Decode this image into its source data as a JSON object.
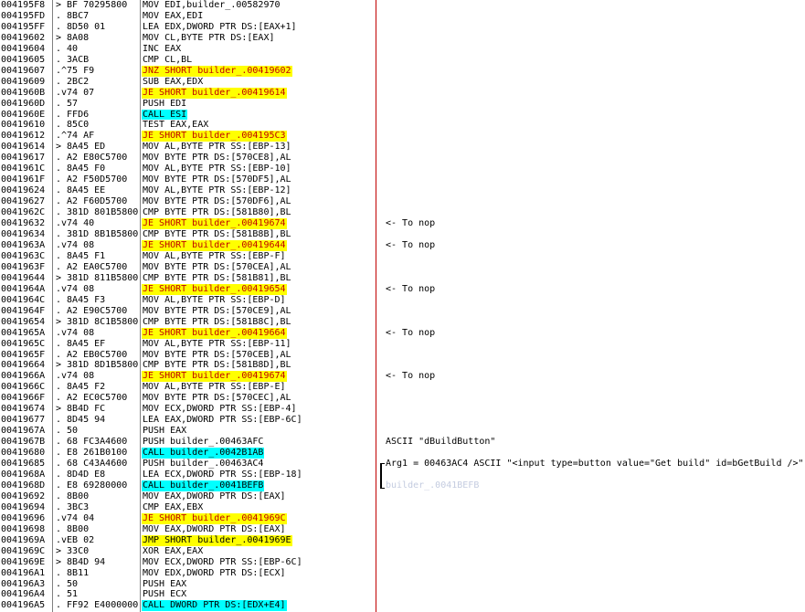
{
  "colors": {
    "text": "#000000",
    "background": "#ffffff",
    "column_divider": "#808080",
    "comment_divider": "#c00000"
  },
  "rows": [
    {
      "addr": "004195F8",
      "hex": "> BF 70295800",
      "asm": "MOV EDI,builder_.00582970"
    },
    {
      "addr": "004195FD",
      "hex": ". 8BC7",
      "asm": "MOV EAX,EDI"
    },
    {
      "addr": "004195FF",
      "hex": ". 8D50 01",
      "asm": "LEA EDX,DWORD PTR DS:[EAX+1]"
    },
    {
      "addr": "00419602",
      "hex": "> 8A08",
      "asm": "MOV CL,BYTE PTR DS:[EAX]"
    },
    {
      "addr": "00419604",
      "hex": ". 40",
      "asm": "INC EAX"
    },
    {
      "addr": "00419605",
      "hex": ". 3ACB",
      "asm": "CMP CL,BL"
    },
    {
      "addr": "00419607",
      "hex": ".^75 F9",
      "asm": "JNZ SHORT builder_.00419602",
      "bg": "#ffff00",
      "fg": "#c00000"
    },
    {
      "addr": "00419609",
      "hex": ". 2BC2",
      "asm": "SUB EAX,EDX"
    },
    {
      "addr": "0041960B",
      "hex": ".v74 07",
      "asm": "JE SHORT builder_.00419614",
      "bg": "#ffff00",
      "fg": "#c00000"
    },
    {
      "addr": "0041960D",
      "hex": ". 57",
      "asm": "PUSH EDI"
    },
    {
      "addr": "0041960E",
      "hex": ". FFD6",
      "asm": "CALL ESI",
      "bg": "#00ffff",
      "fg": "#000000"
    },
    {
      "addr": "00419610",
      "hex": ". 85C0",
      "asm": "TEST EAX,EAX"
    },
    {
      "addr": "00419612",
      "hex": ".^74 AF",
      "asm": "JE SHORT builder_.004195C3",
      "bg": "#ffff00",
      "fg": "#c00000"
    },
    {
      "addr": "00419614",
      "hex": "> 8A45 ED",
      "asm": "MOV AL,BYTE PTR SS:[EBP-13]"
    },
    {
      "addr": "00419617",
      "hex": ". A2 E80C5700",
      "asm": "MOV BYTE PTR DS:[570CE8],AL"
    },
    {
      "addr": "0041961C",
      "hex": ". 8A45 F0",
      "asm": "MOV AL,BYTE PTR SS:[EBP-10]"
    },
    {
      "addr": "0041961F",
      "hex": ". A2 F50D5700",
      "asm": "MOV BYTE PTR DS:[570DF5],AL"
    },
    {
      "addr": "00419624",
      "hex": ". 8A45 EE",
      "asm": "MOV AL,BYTE PTR SS:[EBP-12]"
    },
    {
      "addr": "00419627",
      "hex": ". A2 F60D5700",
      "asm": "MOV BYTE PTR DS:[570DF6],AL"
    },
    {
      "addr": "0041962C",
      "hex": ". 381D 801B5800",
      "asm": "CMP BYTE PTR DS:[581B80],BL"
    },
    {
      "addr": "00419632",
      "hex": ".v74 40",
      "asm": "JE SHORT builder_.00419674",
      "bg": "#ffff00",
      "fg": "#c00000",
      "comment": "<- To nop"
    },
    {
      "addr": "00419634",
      "hex": ". 381D 8B1B5800",
      "asm": "CMP BYTE PTR DS:[581B8B],BL"
    },
    {
      "addr": "0041963A",
      "hex": ".v74 08",
      "asm": "JE SHORT builder_.00419644",
      "bg": "#ffff00",
      "fg": "#c00000",
      "comment": "<- To nop"
    },
    {
      "addr": "0041963C",
      "hex": ". 8A45 F1",
      "asm": "MOV AL,BYTE PTR SS:[EBP-F]"
    },
    {
      "addr": "0041963F",
      "hex": ". A2 EA0C5700",
      "asm": "MOV BYTE PTR DS:[570CEA],AL"
    },
    {
      "addr": "00419644",
      "hex": "> 381D 811B5800",
      "asm": "CMP BYTE PTR DS:[581B81],BL"
    },
    {
      "addr": "0041964A",
      "hex": ".v74 08",
      "asm": "JE SHORT builder_.00419654",
      "bg": "#ffff00",
      "fg": "#c00000",
      "comment": "<- To nop"
    },
    {
      "addr": "0041964C",
      "hex": ". 8A45 F3",
      "asm": "MOV AL,BYTE PTR SS:[EBP-D]"
    },
    {
      "addr": "0041964F",
      "hex": ". A2 E90C5700",
      "asm": "MOV BYTE PTR DS:[570CE9],AL"
    },
    {
      "addr": "00419654",
      "hex": "> 381D 8C1B5800",
      "asm": "CMP BYTE PTR DS:[581B8C],BL"
    },
    {
      "addr": "0041965A",
      "hex": ".v74 08",
      "asm": "JE SHORT builder_.00419664",
      "bg": "#ffff00",
      "fg": "#c00000",
      "comment": "<- To nop"
    },
    {
      "addr": "0041965C",
      "hex": ". 8A45 EF",
      "asm": "MOV AL,BYTE PTR SS:[EBP-11]"
    },
    {
      "addr": "0041965F",
      "hex": ". A2 EB0C5700",
      "asm": "MOV BYTE PTR DS:[570CEB],AL"
    },
    {
      "addr": "00419664",
      "hex": "> 381D 8D1B5800",
      "asm": "CMP BYTE PTR DS:[581B8D],BL"
    },
    {
      "addr": "0041966A",
      "hex": ".v74 08",
      "asm": "JE SHORT builder_.00419674",
      "bg": "#ffff00",
      "fg": "#c00000",
      "comment": "<- To nop"
    },
    {
      "addr": "0041966C",
      "hex": ". 8A45 F2",
      "asm": "MOV AL,BYTE PTR SS:[EBP-E]"
    },
    {
      "addr": "0041966F",
      "hex": ". A2 EC0C5700",
      "asm": "MOV BYTE PTR DS:[570CEC],AL"
    },
    {
      "addr": "00419674",
      "hex": "> 8B4D FC",
      "asm": "MOV ECX,DWORD PTR SS:[EBP-4]"
    },
    {
      "addr": "00419677",
      "hex": ". 8D45 94",
      "asm": "LEA EAX,DWORD PTR SS:[EBP-6C]"
    },
    {
      "addr": "0041967A",
      "hex": ". 50",
      "asm": "PUSH EAX"
    },
    {
      "addr": "0041967B",
      "hex": ". 68 FC3A4600",
      "asm": "PUSH builder_.00463AFC",
      "comment": "ASCII \"dBuildButton\""
    },
    {
      "addr": "00419680",
      "hex": ". E8 261B0100",
      "asm": "CALL builder_.0042B1AB",
      "bg": "#00ffff",
      "fg": "#000000"
    },
    {
      "addr": "00419685",
      "hex": ". 68 C43A4600",
      "asm": "PUSH builder_.00463AC4",
      "comment": "Arg1 = 00463AC4 ASCII \"<input type=button value=\"Get build\" id=bGetBuild />\""
    },
    {
      "addr": "0041968A",
      "hex": ". 8D4D E8",
      "asm": "LEA ECX,DWORD PTR SS:[EBP-18]"
    },
    {
      "addr": "0041968D",
      "hex": ". E8 69280000",
      "asm": "CALL builder_.0041BEFB",
      "bg": "#00ffff",
      "fg": "#000000",
      "comment": "builder_.0041BEFB",
      "comment_color": "#c4cce0"
    },
    {
      "addr": "00419692",
      "hex": ". 8B00",
      "asm": "MOV EAX,DWORD PTR DS:[EAX]"
    },
    {
      "addr": "00419694",
      "hex": ". 3BC3",
      "asm": "CMP EAX,EBX"
    },
    {
      "addr": "00419696",
      "hex": ".v74 04",
      "asm": "JE SHORT builder_.0041969C",
      "bg": "#ffff00",
      "fg": "#c00000"
    },
    {
      "addr": "00419698",
      "hex": ". 8B00",
      "asm": "MOV EAX,DWORD PTR DS:[EAX]"
    },
    {
      "addr": "0041969A",
      "hex": ".vEB 02",
      "asm": "JMP SHORT builder_.0041969E",
      "bg": "#ffff00",
      "fg": "#000000"
    },
    {
      "addr": "0041969C",
      "hex": "> 33C0",
      "asm": "XOR EAX,EAX"
    },
    {
      "addr": "0041969E",
      "hex": "> 8B4D 94",
      "asm": "MOV ECX,DWORD PTR SS:[EBP-6C]"
    },
    {
      "addr": "004196A1",
      "hex": ". 8B11",
      "asm": "MOV EDX,DWORD PTR DS:[ECX]"
    },
    {
      "addr": "004196A3",
      "hex": ". 50",
      "asm": "PUSH EAX"
    },
    {
      "addr": "004196A4",
      "hex": ". 51",
      "asm": "PUSH ECX"
    },
    {
      "addr": "004196A5",
      "hex": ". FF92 E4000000",
      "asm": "CALL DWORD PTR DS:[EDX+E4]",
      "bg": "#00ffff",
      "fg": "#000000"
    }
  ]
}
